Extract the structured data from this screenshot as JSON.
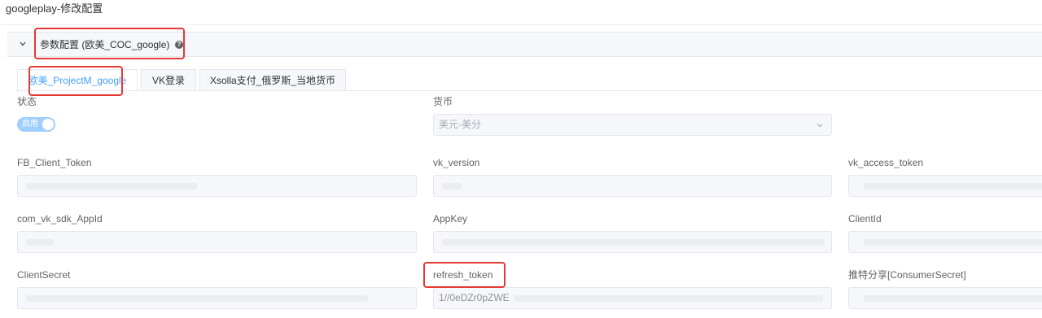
{
  "page": {
    "title": "googleplay-修改配置"
  },
  "panel": {
    "title": "参数配置 (欧美_COC_google)",
    "help_icon": "question-circle-icon"
  },
  "tabs": [
    {
      "label": "欧美_ProjectM_google",
      "active": true
    },
    {
      "label": "VK登录",
      "active": false
    },
    {
      "label": "Xsolla支付_俄罗斯_当地货币",
      "active": false
    }
  ],
  "form": {
    "status": {
      "label": "状态",
      "toggle_text": "启用",
      "enabled": true
    },
    "currency": {
      "label": "货币",
      "value": "美元-美分"
    },
    "fields": {
      "fb_client_token": {
        "label": "FB_Client_Token"
      },
      "vk_version": {
        "label": "vk_version"
      },
      "vk_access_token": {
        "label": "vk_access_token"
      },
      "com_vk_sdk_appid": {
        "label": "com_vk_sdk_AppId"
      },
      "appkey": {
        "label": "AppKey"
      },
      "clientid": {
        "label": "ClientId"
      },
      "clientsecret": {
        "label": "ClientSecret"
      },
      "refresh_token": {
        "label": "refresh_token",
        "value": "1//0eDZr0pZWE"
      },
      "consumer_secret": {
        "label": "推特分享[ConsumerSecret]"
      }
    }
  },
  "colors": {
    "accent": "#409eff",
    "highlight": "#e53935",
    "toggle_on": "#a0cfff"
  }
}
